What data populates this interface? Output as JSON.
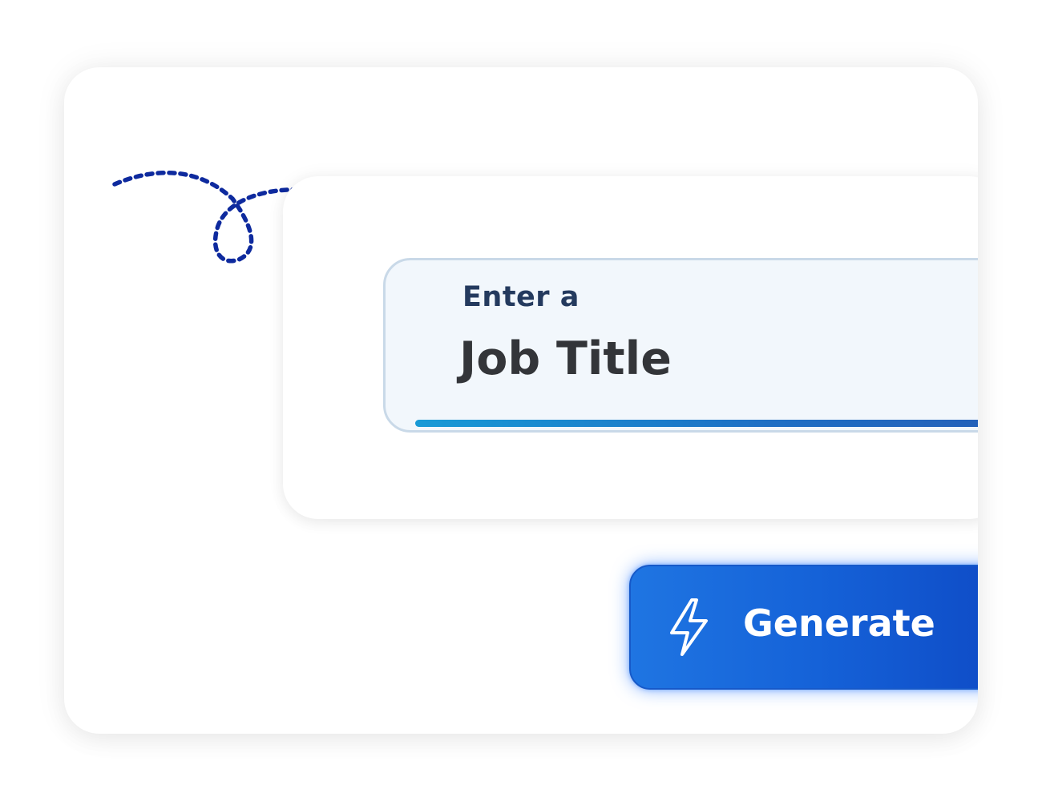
{
  "form": {
    "input_label": "Enter a",
    "input_value": "Job Title"
  },
  "actions": {
    "generate_label": "Generate",
    "generate_icon": "lightning-bolt-icon"
  },
  "decoration": {
    "arrow_icon": "curly-dashed-arrow-icon",
    "arrow_color": "#0e2a9e"
  },
  "colors": {
    "input_background": "#f2f7fc",
    "input_border": "#c9d9e8",
    "focus_gradient_start": "#189ad6",
    "focus_gradient_end": "#2857b2",
    "button_gradient_start": "#1f75e2",
    "button_gradient_end": "#0d46c2"
  }
}
